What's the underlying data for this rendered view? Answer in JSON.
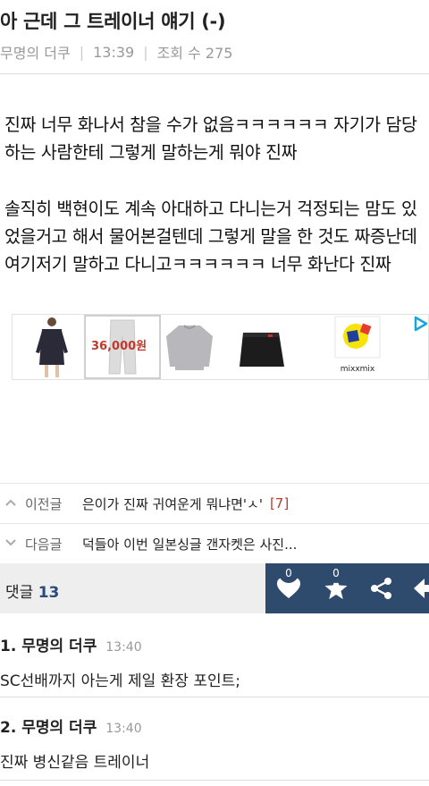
{
  "post": {
    "title": "아 근데 그 트레이너 얘기 (-)",
    "author": "무명의 더쿠",
    "time": "13:39",
    "views_label": "조회 수 275",
    "body": "진짜 너무 화나서 참을 수가 없음ㅋㅋㅋㅋㅋㅋ 자기가 담당하는 사람한테 그렇게 말하는게 뭐야 진짜\n\n솔직히 백현이도 계속 아대하고 다니는거 걱정되는 맘도 있었을거고 해서 물어본걸텐데 그렇게 말을 한 것도 짜증난데 여기저기 말하고 다니고ㅋㅋㅋㅋㅋㅋ 너무 화난다 진짜"
  },
  "ad": {
    "price": "36,000원",
    "brand": "mixxmix",
    "items": [
      "dark-dress",
      "white-pants",
      "grey-sweatshirt",
      "black-skirt",
      "mixxmix-logo"
    ]
  },
  "nav": {
    "prev_label": "이전글",
    "prev_title": "은이가 진짜 귀여운게 뭐냐면'ㅅ'",
    "prev_count": "[7]",
    "next_label": "다음글",
    "next_title": "덕들아 이번 일본싱글 갠자켓은 사진..."
  },
  "comments_bar": {
    "label": "댓글",
    "count": "13",
    "like_count": "0",
    "star_count": "0"
  },
  "comments": [
    {
      "num": "1.",
      "author": "무명의 더쿠",
      "time": "13:40",
      "text": "SC선배까지 아는게 제일 환장 포인트;"
    },
    {
      "num": "2.",
      "author": "무명의 더쿠",
      "time": "13:40",
      "text": "진짜 병신같음 트레이너"
    }
  ],
  "colors": {
    "action_bar": "#2e4a6d",
    "count_accent": "#2b4a7e",
    "price": "#c0392b"
  }
}
